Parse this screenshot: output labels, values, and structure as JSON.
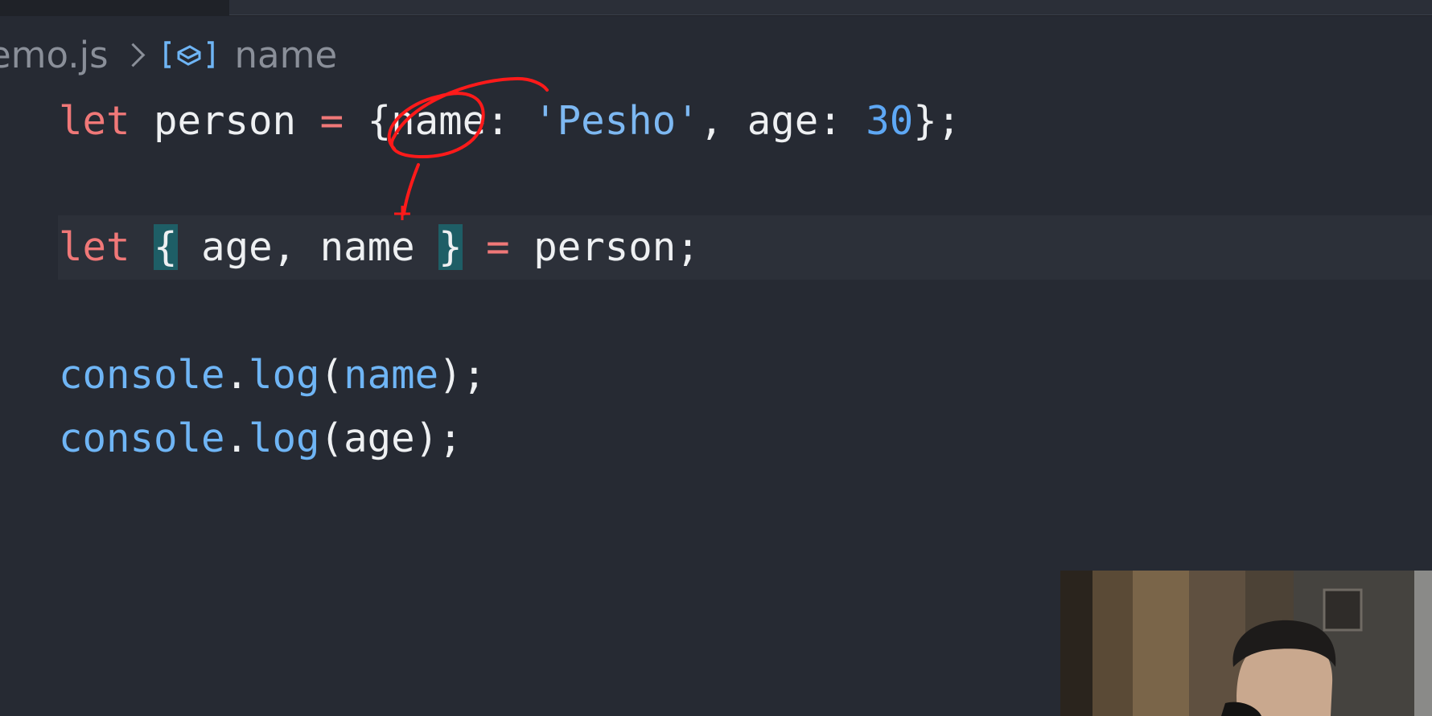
{
  "breadcrumb": {
    "file": "emo.js",
    "chevron_icon": "chevron-right-icon",
    "symbol_icon": "symbol-variable-icon",
    "symbol": "name"
  },
  "code": {
    "line1": {
      "kw": "let",
      "id": "person",
      "op": "=",
      "open": "{",
      "prop1": "name",
      "colon1": ":",
      "str": "'Pesho'",
      "comma": ",",
      "prop2": "age",
      "colon2": ":",
      "num": "30",
      "close": "}",
      "semi": ";"
    },
    "line2": {
      "kw": "let",
      "open": "{",
      "var1": "age",
      "comma": ",",
      "var2": "name",
      "close": "}",
      "op": "=",
      "rhs": "person",
      "semi": ";"
    },
    "line3": {
      "obj": "console",
      "dot": ".",
      "method": "log",
      "lparen": "(",
      "arg": "name",
      "rparen": ")",
      "semi": ";"
    },
    "line4": {
      "obj": "console",
      "dot": ".",
      "method": "log",
      "lparen": "(",
      "arg": "age",
      "rparen": ")",
      "semi": ";"
    }
  },
  "colors": {
    "background": "#262a33",
    "keyword": "#f07878",
    "function": "#6fb5f5",
    "string": "#7db8f2",
    "number": "#5ea8f5",
    "bracket_match": "#1e5e66",
    "annotation": "#ff1a1a"
  }
}
